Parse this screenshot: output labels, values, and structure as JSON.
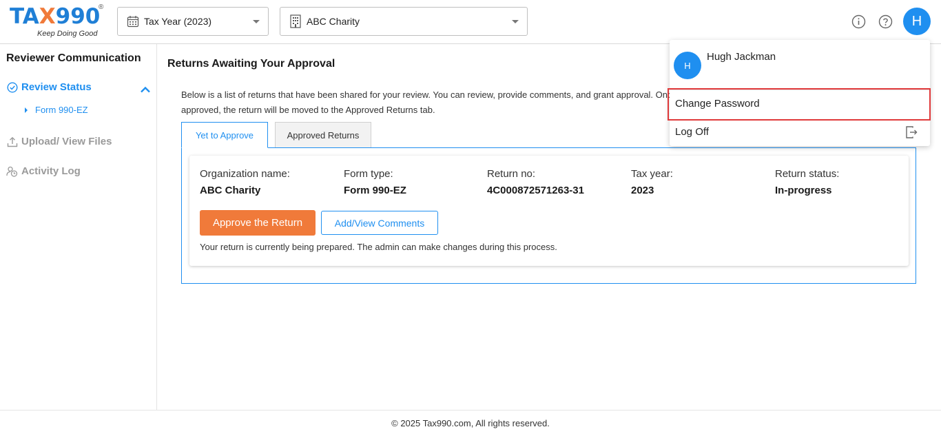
{
  "brand": {
    "logo_part1": "TA",
    "logo_part2": "X",
    "logo_part3": "990",
    "registered": "®",
    "tagline": "Keep Doing Good",
    "colors": {
      "primary": "#1f8ff0",
      "accent": "#f07a3a"
    }
  },
  "header": {
    "tax_year_select": {
      "value": "Tax Year (2023)",
      "icon": "calendar-icon"
    },
    "org_select": {
      "value": "ABC Charity",
      "icon": "building-icon"
    },
    "info_icon": "info-icon",
    "help_icon": "help-icon",
    "avatar_letter": "H"
  },
  "sidebar": {
    "title": "Reviewer Communication",
    "items": [
      {
        "label": "Review Status",
        "icon": "check-circle-icon",
        "active": true
      },
      {
        "label": "Upload/ View Files",
        "icon": "upload-icon",
        "active": false
      },
      {
        "label": "Activity Log",
        "icon": "activity-log-icon",
        "active": false
      }
    ],
    "subitems": [
      {
        "label": "Form 990-EZ"
      }
    ]
  },
  "main": {
    "title": "Returns Awaiting Your Approval",
    "description": "Below is a list of returns that have been shared for your review. You can review, provide comments, and grant approval. Once approved, the return will be moved to the Approved Returns tab.",
    "tabs": [
      {
        "label": "Yet to Approve",
        "active": true
      },
      {
        "label": "Approved Returns",
        "active": false
      }
    ],
    "card": {
      "fields": [
        {
          "label": "Organization name:",
          "value": "ABC Charity"
        },
        {
          "label": "Form type:",
          "value": "Form 990-EZ"
        },
        {
          "label": "Return no:",
          "value": "4C000872571263-31"
        },
        {
          "label": "Tax year:",
          "value": "2023"
        },
        {
          "label": "Return status:",
          "value": "In-progress"
        }
      ],
      "approve_button": "Approve the Return",
      "comments_button": "Add/View Comments",
      "note": "Your return is currently being prepared. The admin can make changes during this process."
    }
  },
  "user_menu": {
    "avatar_letter": "H",
    "name": "Hugh Jackman",
    "items": [
      {
        "label": "Change Password"
      },
      {
        "label": "Log Off",
        "icon": "log-off-icon"
      }
    ]
  },
  "footer": {
    "text": "© 2025 Tax990.com, All rights reserved."
  }
}
